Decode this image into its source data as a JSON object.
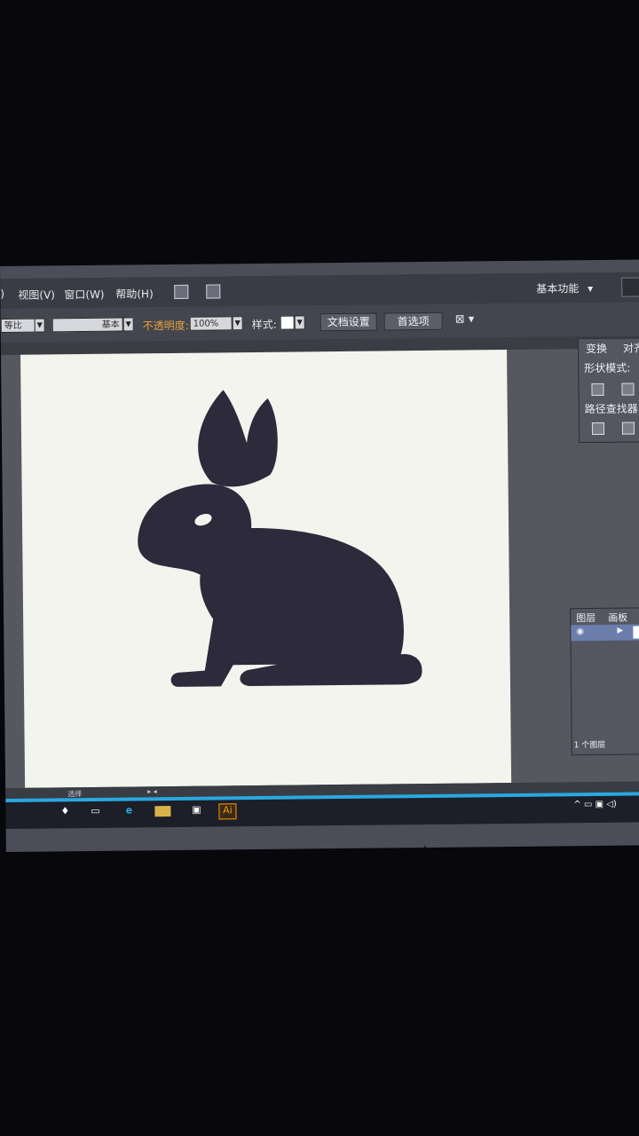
{
  "menu": {
    "cut_item": ")",
    "view": "视图(V)",
    "window": "窗口(W)",
    "help": "帮助(H)",
    "workspace": "基本功能",
    "workspace_arrow": "▾"
  },
  "controls": {
    "uniform": "等比",
    "stroke_profile": "基本",
    "opacity_label": "不透明度:",
    "opacity_value": "100%",
    "style_label": "样式:",
    "doc_setup": "文档设置",
    "preferences": "首选项"
  },
  "panels": {
    "transform_tab": "变换",
    "align_tab": "对齐",
    "shape_modes": "形状模式:",
    "pathfinder": "路径查找器:",
    "layers_tab": "图层",
    "artboards_tab": "画板",
    "layers_count": "1 个图层"
  },
  "status": {
    "tool": "选择"
  },
  "taskbar": {
    "ai_label": "Ai"
  },
  "colors": {
    "rabbit": "#2c2a3b",
    "accent_opacity_label": "#e8a23a",
    "edge_blue": "#2aa8e0"
  }
}
